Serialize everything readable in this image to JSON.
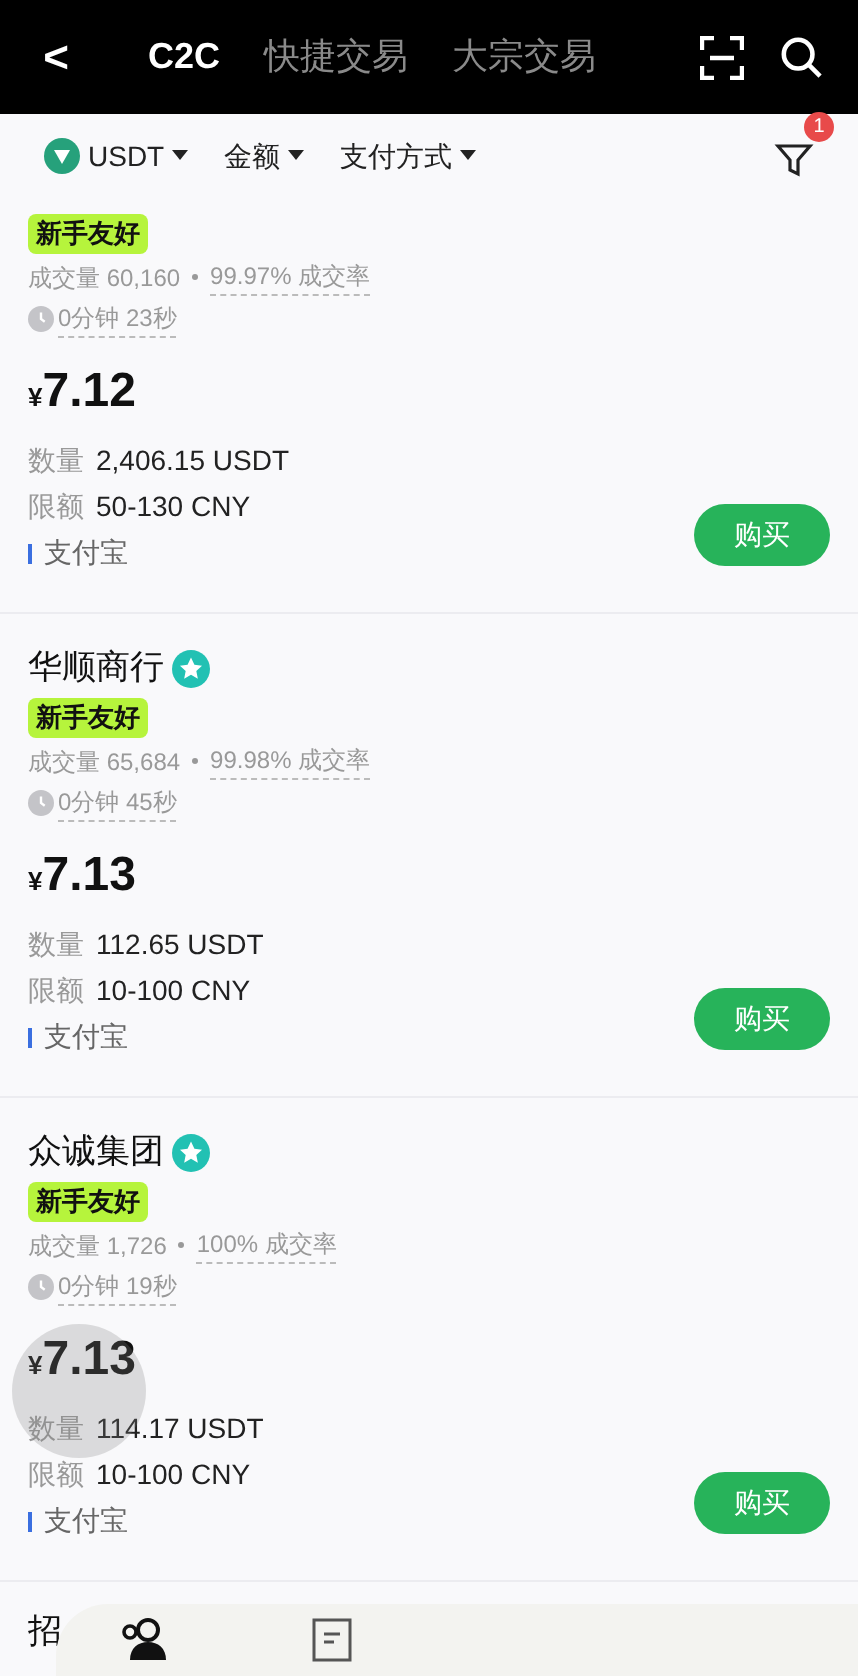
{
  "header": {
    "back": "<",
    "tabs": [
      {
        "label": "C2C",
        "selected": true
      },
      {
        "label": "快捷交易",
        "selected": false
      },
      {
        "label": "大宗交易",
        "selected": false
      }
    ]
  },
  "filters": [
    {
      "label": "USDT",
      "kind": "coin"
    },
    {
      "label": "金额",
      "kind": "plain"
    },
    {
      "label": "支付方式",
      "kind": "plain"
    }
  ],
  "filter_badge": "1",
  "listings": [
    {
      "tag": "新手友好",
      "volume": "成交量 60,160",
      "rate": "99.97% 成交率",
      "time": "0分钟 23秒",
      "currency": "¥",
      "price": "7.12",
      "quantity_label": "数量",
      "quantity": "2,406.15 USDT",
      "limit_label": "限额",
      "limit": "50-130 CNY",
      "payment": "支付宝",
      "button": "购买"
    },
    {
      "name": "华顺商行",
      "verified": true,
      "tag": "新手友好",
      "volume": "成交量 65,684",
      "rate": "99.98% 成交率",
      "time": "0分钟 45秒",
      "currency": "¥",
      "price": "7.13",
      "quantity_label": "数量",
      "quantity": "112.65 USDT",
      "limit_label": "限额",
      "limit": "10-100 CNY",
      "payment": "支付宝",
      "button": "购买"
    },
    {
      "name": "众诚集团",
      "verified": true,
      "tag": "新手友好",
      "volume": "成交量 1,726",
      "rate": "100% 成交率",
      "time": "0分钟 19秒",
      "currency": "¥",
      "price": "7.13",
      "quantity_label": "数量",
      "quantity": "114.17 USDT",
      "limit_label": "限额",
      "limit": "10-100 CNY",
      "payment": "支付宝",
      "button": "购买"
    }
  ],
  "next_listing_name": "招"
}
